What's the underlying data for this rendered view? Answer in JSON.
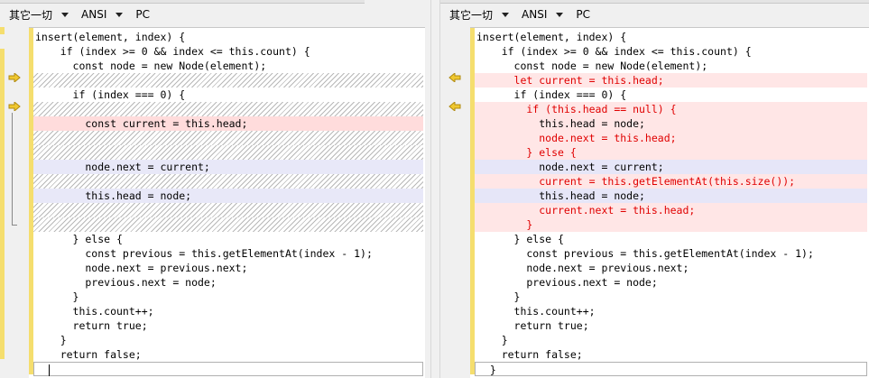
{
  "toolbar": {
    "encoding_group": "其它一切",
    "charset": "ANSI",
    "line_ending": "PC"
  },
  "left": {
    "lines": [
      {
        "text": "insert(element, index) {",
        "kind": "norm"
      },
      {
        "text": "    if (index >= 0 && index <= this.count) {",
        "kind": "norm"
      },
      {
        "text": "      const node = new Node(element);",
        "kind": "norm"
      },
      {
        "text": "",
        "kind": "hatch"
      },
      {
        "text": "      if (index === 0) {",
        "kind": "norm"
      },
      {
        "text": "",
        "kind": "hatch"
      },
      {
        "text": "        const current = this.head;",
        "kind": "rem"
      },
      {
        "text": "",
        "kind": "hatch"
      },
      {
        "text": "",
        "kind": "hatch"
      },
      {
        "text": "        node.next = current;",
        "kind": "mod"
      },
      {
        "text": "",
        "kind": "hatch"
      },
      {
        "text": "        this.head = node;",
        "kind": "mod"
      },
      {
        "text": "",
        "kind": "hatch"
      },
      {
        "text": "",
        "kind": "hatch"
      },
      {
        "text": "      } else {",
        "kind": "norm"
      },
      {
        "text": "        const previous = this.getElementAt(index - 1);",
        "kind": "norm"
      },
      {
        "text": "        node.next = previous.next;",
        "kind": "norm"
      },
      {
        "text": "        previous.next = node;",
        "kind": "norm"
      },
      {
        "text": "      }",
        "kind": "norm"
      },
      {
        "text": "      this.count++;",
        "kind": "norm"
      },
      {
        "text": "      return true;",
        "kind": "norm"
      },
      {
        "text": "    }",
        "kind": "norm"
      },
      {
        "text": "    return false;",
        "kind": "norm"
      },
      {
        "text": "  ",
        "kind": "last"
      }
    ]
  },
  "right": {
    "lines": [
      {
        "text": "insert(element, index) {",
        "kind": "norm"
      },
      {
        "text": "    if (index >= 0 && index <= this.count) {",
        "kind": "norm"
      },
      {
        "text": "      const node = new Node(element);",
        "kind": "norm"
      },
      {
        "text": "      let current = this.head;",
        "kind": "add"
      },
      {
        "text": "      if (index === 0) {",
        "kind": "norm"
      },
      {
        "text": "        if (this.head == null) {",
        "kind": "add"
      },
      {
        "text": "          this.head = node;",
        "kind": "redbg"
      },
      {
        "text": "          node.next = this.head;",
        "kind": "add"
      },
      {
        "text": "        } else {",
        "kind": "add"
      },
      {
        "text": "          node.next = current;",
        "kind": "modr"
      },
      {
        "text": "          current = this.getElementAt(this.size());",
        "kind": "add"
      },
      {
        "text": "          this.head = node;",
        "kind": "modr"
      },
      {
        "text": "          current.next = this.head;",
        "kind": "add"
      },
      {
        "text": "        }",
        "kind": "add"
      },
      {
        "text": "      } else {",
        "kind": "norm"
      },
      {
        "text": "        const previous = this.getElementAt(index - 1);",
        "kind": "norm"
      },
      {
        "text": "        node.next = previous.next;",
        "kind": "norm"
      },
      {
        "text": "        previous.next = node;",
        "kind": "norm"
      },
      {
        "text": "      }",
        "kind": "norm"
      },
      {
        "text": "      this.count++;",
        "kind": "norm"
      },
      {
        "text": "      return true;",
        "kind": "norm"
      },
      {
        "text": "    }",
        "kind": "norm"
      },
      {
        "text": "    return false;",
        "kind": "norm"
      },
      {
        "text": "  }",
        "kind": "last"
      }
    ]
  },
  "icons": {
    "left_marker": "arrow-right-icon",
    "right_marker": "arrow-left-icon"
  },
  "colors": {
    "change_bar": "#f5de6e",
    "removed_bg": "#ffdcdc",
    "added_text": "#e00000",
    "modified_bg": "#e8e8f8"
  }
}
